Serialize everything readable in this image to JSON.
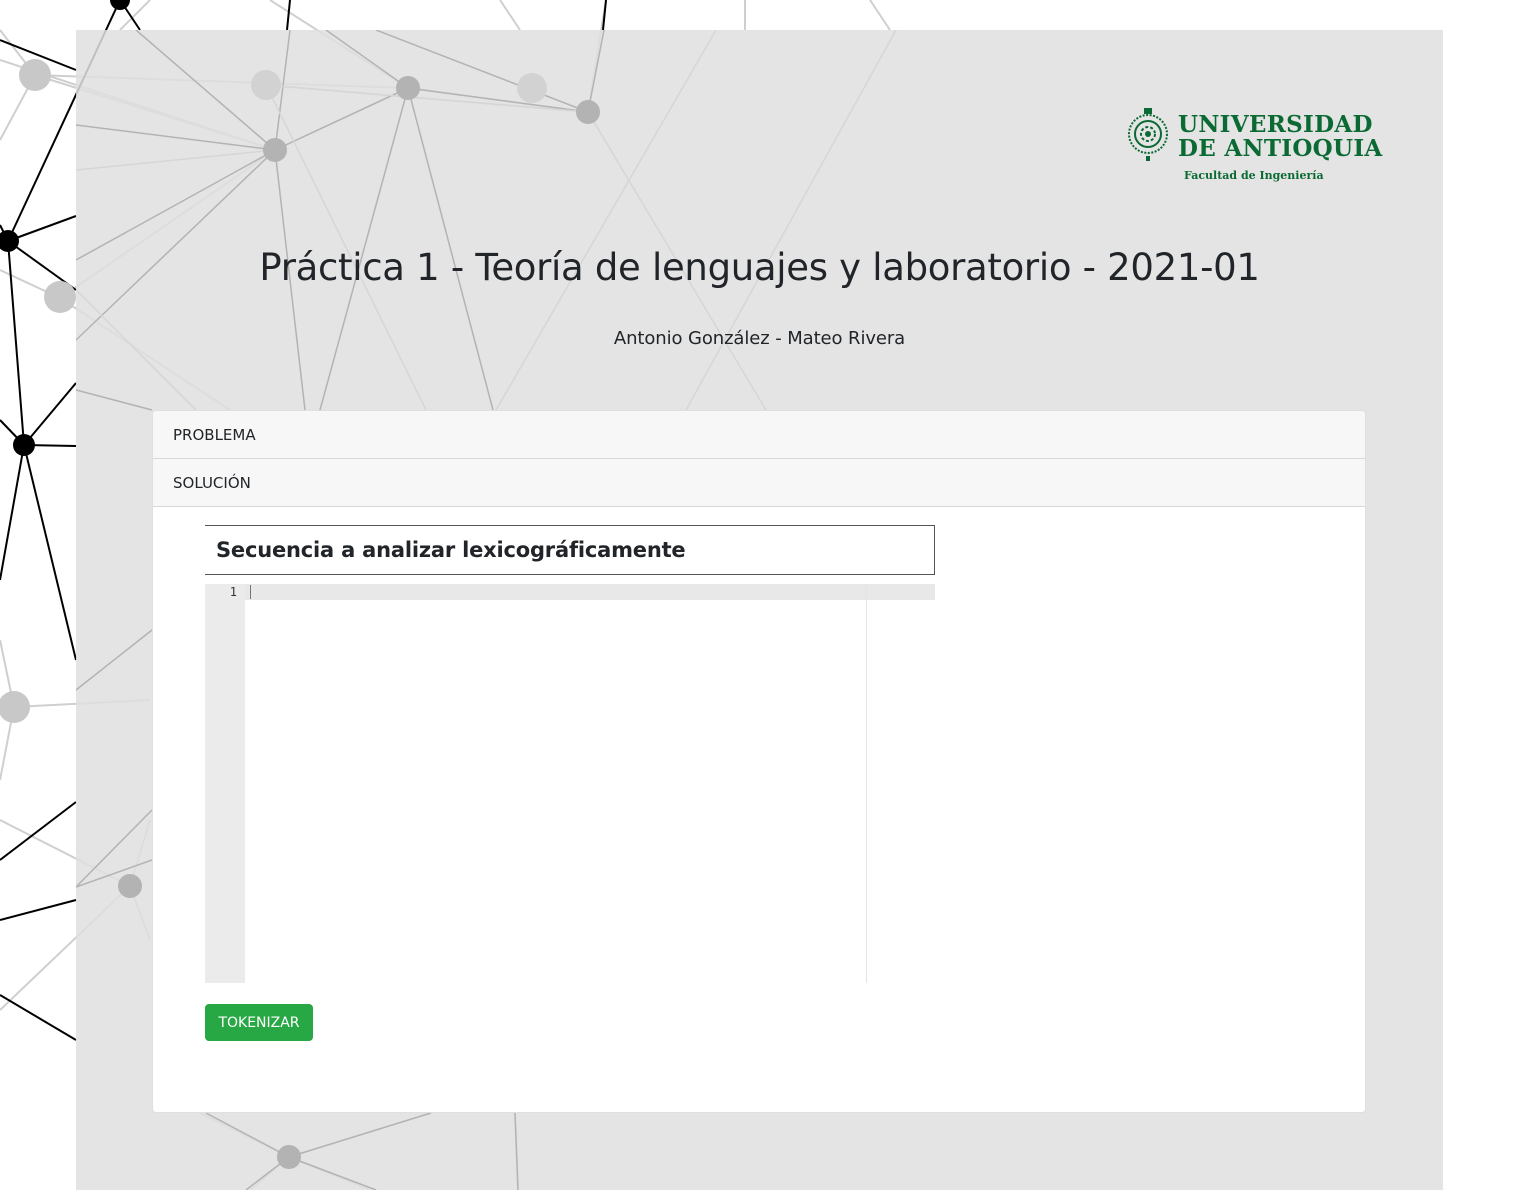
{
  "header": {
    "logo": {
      "line1": "UNIVERSIDAD",
      "line2": "DE ANTIOQUIA",
      "subtitle": "Facultad de Ingeniería",
      "color": "#0b6a33"
    },
    "title": "Práctica 1 - Teoría de lenguajes y laboratorio - 2021-01",
    "authors": "Antonio González - Mateo Rivera"
  },
  "accordion": {
    "items": [
      {
        "label": "PROBLEMA"
      },
      {
        "label": "SOLUCIÓN"
      }
    ]
  },
  "solution": {
    "section_title": "Secuencia a analizar lexicográficamente",
    "editor": {
      "line_numbers": [
        "1"
      ],
      "content": ""
    },
    "tokenize_label": "TOKENIZAR"
  },
  "colors": {
    "panel_bg": "#e0e0e0",
    "button_green": "#28a745",
    "accordion_header_bg": "#f7f7f7"
  }
}
